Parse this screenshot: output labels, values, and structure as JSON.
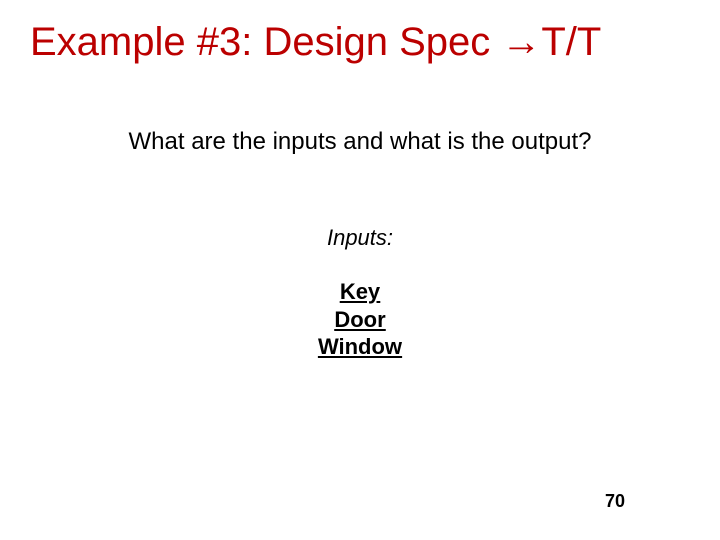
{
  "title": "Example #3: Design Spec →T/T",
  "question": "What are the inputs and what is the output?",
  "inputs_label": "Inputs:",
  "inputs": [
    "Key",
    "Door",
    "Window"
  ],
  "page_number": "70"
}
